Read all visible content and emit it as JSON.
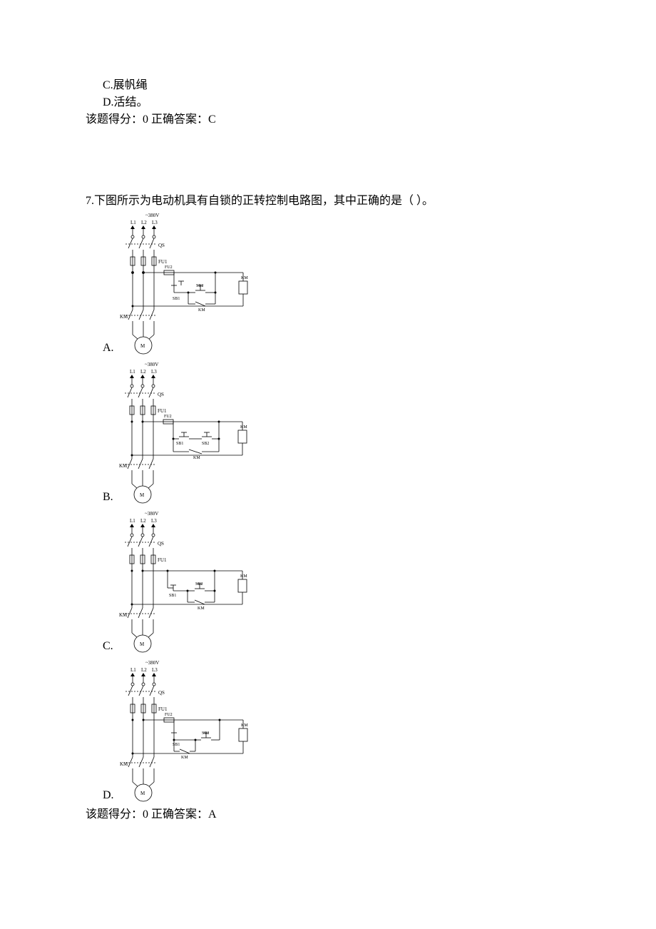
{
  "q6": {
    "opt_c": "C.展帆绳",
    "opt_d": "D.活结。",
    "result": "该题得分：0 正确答案：C"
  },
  "q7": {
    "stem": "7.下图所示为电动机具有自锁的正转控制电路图，其中正确的是（ ）。",
    "labels": {
      "voltage": "~380V",
      "L1": "L1",
      "L2": "L2",
      "L3": "L3",
      "QS": "QS",
      "FU1": "FU1",
      "FU2": "FU2",
      "SB1": "SB1",
      "SB2": "SB2",
      "KM": "KM",
      "M": "M"
    },
    "opt_a": "A.",
    "opt_b": "B.",
    "opt_c": "C.",
    "opt_d": "D.",
    "result": "该题得分：0 正确答案：A"
  }
}
